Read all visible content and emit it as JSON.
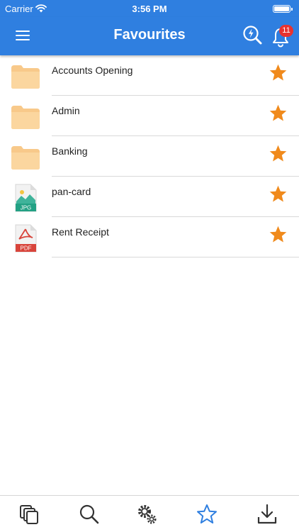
{
  "status_bar": {
    "carrier": "Carrier",
    "time": "3:56 PM"
  },
  "header": {
    "title": "Favourites",
    "notification_count": "11",
    "icons": [
      "menu-icon",
      "quick-search-icon",
      "bell-icon"
    ]
  },
  "colors": {
    "primary": "#2f7fe0",
    "star": "#f08a1c",
    "folder": "#f8c98a",
    "badge": "#e8322f",
    "tab_active": "#2f7fe0"
  },
  "items": [
    {
      "name": "Accounts Opening",
      "type": "folder",
      "favourite": true
    },
    {
      "name": "Admin",
      "type": "folder",
      "favourite": true
    },
    {
      "name": "Banking",
      "type": "folder",
      "favourite": true
    },
    {
      "name": "pan-card",
      "type": "jpg",
      "file_label": "JPG",
      "favourite": true
    },
    {
      "name": "Rent Receipt",
      "type": "pdf",
      "file_label": "PDF",
      "favourite": true
    }
  ],
  "tab_bar": {
    "tabs": [
      {
        "icon": "documents-icon",
        "active": false
      },
      {
        "icon": "search-icon",
        "active": false
      },
      {
        "icon": "settings-icon",
        "active": false
      },
      {
        "icon": "star-icon",
        "active": true
      },
      {
        "icon": "download-icon",
        "active": false
      }
    ]
  }
}
